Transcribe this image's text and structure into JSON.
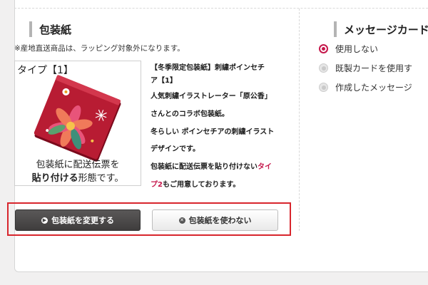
{
  "wrapping": {
    "title": "包装紙",
    "note": "※産地直送商品は、ラッピング対象外になります。",
    "image": {
      "type_label": "タイプ【1】",
      "caption_line1": "包装紙に配送伝票を",
      "caption_line2_bold": "貼り付ける",
      "caption_line2_rest": "形態です。"
    },
    "description": {
      "line1": "【冬季限定包装紙】刺繍ポインセチ",
      "line2": "ア【1】",
      "line3": "人気刺繍イラストレーター「原公香」",
      "line4": "さんとのコラボ包装紙。",
      "line5": "冬らしい ポインセチアの刺繍イラスト",
      "line6": "デザインです。",
      "line7_text": "包装紙に配送伝票を貼り付けない",
      "line7_link": "タイ",
      "line8_link": "プ2",
      "line8_text": "もご用意しております。"
    },
    "buttons": {
      "change_label": "包装紙を変更する",
      "no_use_label": "包装紙を使わない"
    }
  },
  "message_card": {
    "title": "メッセージカード",
    "options": [
      {
        "label": "使用しない",
        "selected": true
      },
      {
        "label": "既製カードを使用す",
        "selected": false
      },
      {
        "label": "作成したメッセージ",
        "selected": false
      }
    ]
  },
  "colors": {
    "accent": "#c5174b",
    "highlight_frame": "#d8262d",
    "dark_button": "#4a4848"
  }
}
